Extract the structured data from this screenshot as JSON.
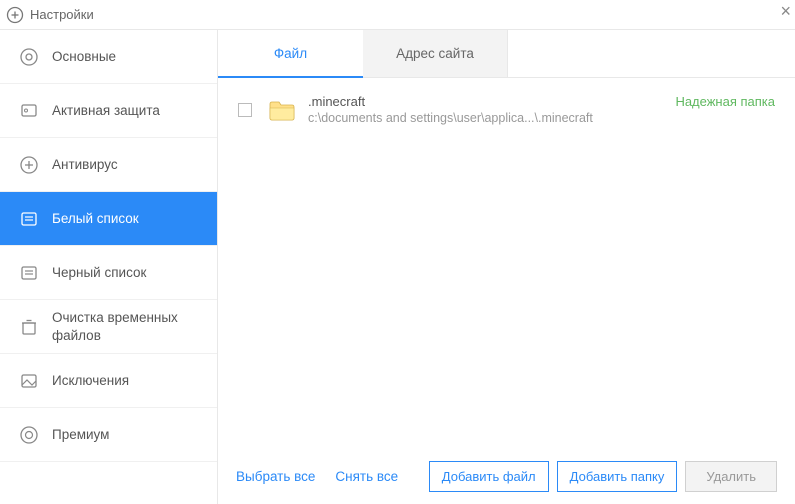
{
  "titlebar": {
    "title": "Настройки",
    "close": "×"
  },
  "sidebar": {
    "items": [
      {
        "label": "Основные"
      },
      {
        "label": "Активная защита"
      },
      {
        "label": "Антивирус"
      },
      {
        "label": "Белый список"
      },
      {
        "label": "Черный список"
      },
      {
        "label": "Очистка временных\nфайлов"
      },
      {
        "label": "Исключения"
      },
      {
        "label": "Премиум"
      }
    ]
  },
  "tabs": {
    "file": "Файл",
    "site": "Адрес сайта"
  },
  "entries": [
    {
      "name": ".minecraft",
      "path": "c:\\documents and settings\\user\\applica...\\.minecraft",
      "status": "Надежная папка"
    }
  ],
  "footer": {
    "select_all": "Выбрать все",
    "deselect_all": "Снять все",
    "add_file": "Добавить файл",
    "add_folder": "Добавить папку",
    "delete": "Удалить"
  }
}
